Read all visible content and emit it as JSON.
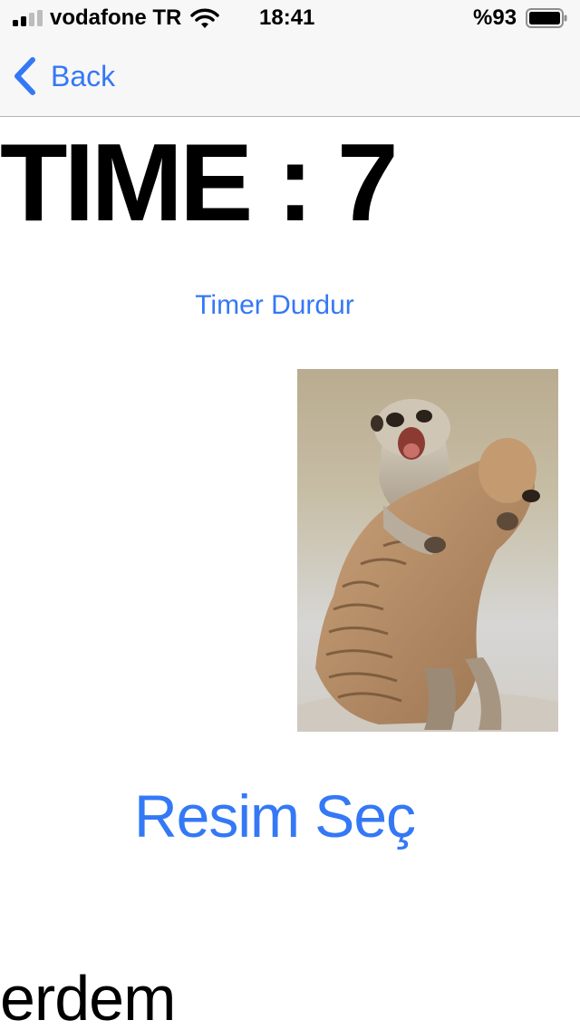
{
  "status_bar": {
    "carrier": "vodafone TR",
    "time": "18:41",
    "battery_percent": "%93",
    "signal_bars_filled": 2,
    "signal_bars_total": 4,
    "battery_level": 0.93,
    "icons": [
      "signal-icon",
      "wifi-icon",
      "battery-icon"
    ]
  },
  "nav_bar": {
    "back_label": "Back",
    "back_icon": "chevron-left-icon"
  },
  "main": {
    "time_text": "TIME : 7",
    "timer_button_label": "Timer Durdur",
    "image_subject": "two meerkats wrestling",
    "choose_image_label": "Resim Seç",
    "footer_text": "erdem"
  },
  "colors": {
    "accent": "#3478f6",
    "text": "#000000",
    "bar_background": "#f7f7f7"
  }
}
